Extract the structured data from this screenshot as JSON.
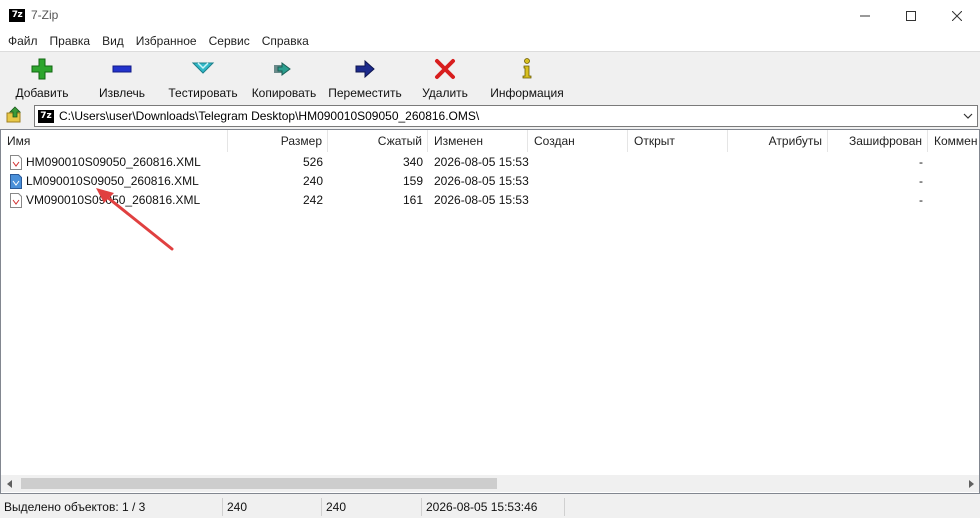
{
  "window": {
    "title": "7-Zip",
    "app_icon_text": "7z"
  },
  "menu": [
    "Файл",
    "Правка",
    "Вид",
    "Избранное",
    "Сервис",
    "Справка"
  ],
  "toolbar": {
    "add": "Добавить",
    "extract": "Извлечь",
    "test": "Тестировать",
    "copy": "Копировать",
    "move": "Переместить",
    "delete": "Удалить",
    "info": "Информация"
  },
  "address": {
    "path": "C:\\Users\\user\\Downloads\\Telegram Desktop\\HM090010S09050_260816.OMS\\"
  },
  "columns": {
    "name": "Имя",
    "size": "Размер",
    "packed": "Сжатый",
    "modified": "Изменен",
    "created": "Создан",
    "accessed": "Открыт",
    "attributes": "Атрибуты",
    "encrypted": "Зашифрован",
    "comment": "Коммен"
  },
  "files": [
    {
      "name": "HM090010S09050_260816.XML",
      "size": "526",
      "packed": "340",
      "modified": "2026-08-05 15:53",
      "encrypted": "-",
      "selected": false
    },
    {
      "name": "LM090010S09050_260816.XML",
      "size": "240",
      "packed": "159",
      "modified": "2026-08-05 15:53",
      "encrypted": "-",
      "selected": true
    },
    {
      "name": "VM090010S09050_260816.XML",
      "size": "242",
      "packed": "161",
      "modified": "2026-08-05 15:53",
      "encrypted": "-",
      "selected": false
    }
  ],
  "status": {
    "selected": "Выделено объектов: 1 / 3",
    "size": "240",
    "packed": "240",
    "modified": "2026-08-05 15:53:46"
  },
  "colors": {
    "annotation_arrow": "#e04040",
    "selection_icon": "#4a90d9"
  }
}
